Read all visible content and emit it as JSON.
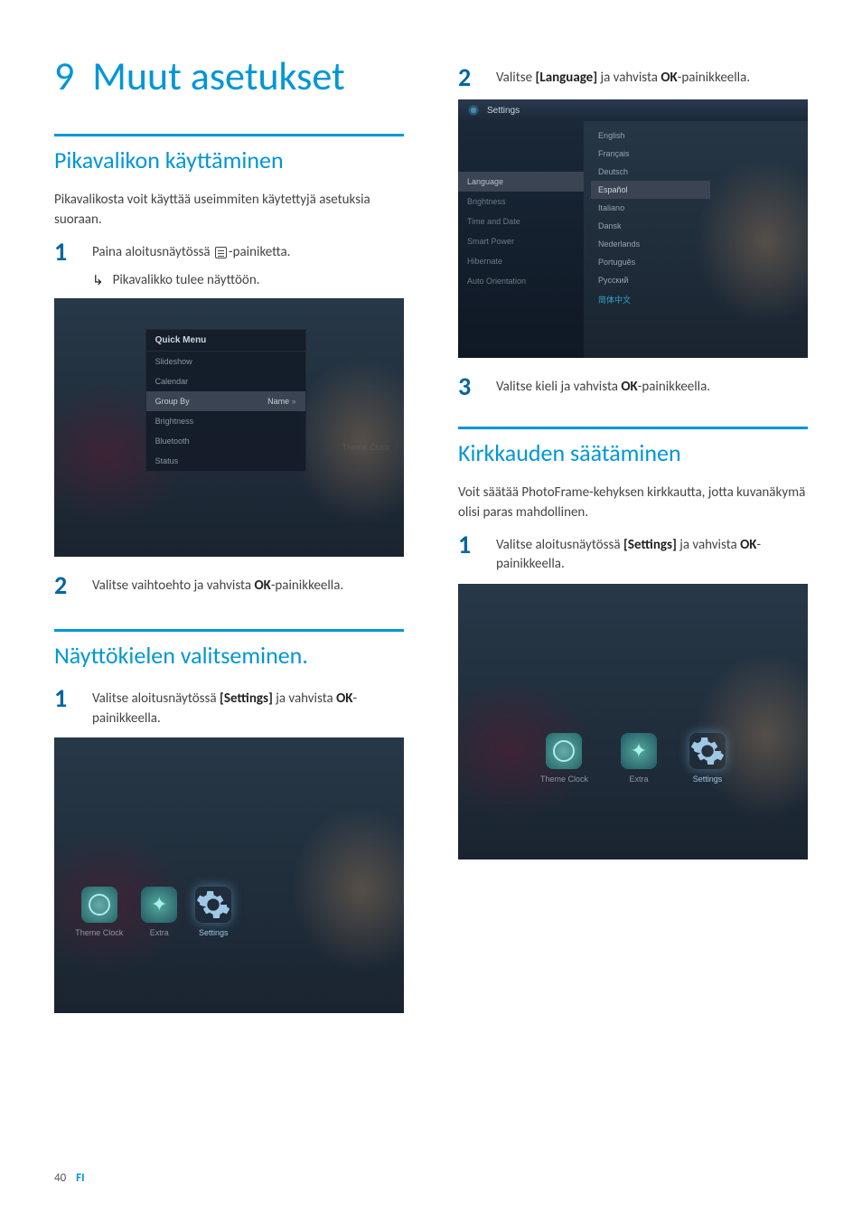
{
  "page": {
    "number": "40",
    "lang_code": "FI"
  },
  "chapter": {
    "number": "9",
    "title": "Muut asetukset"
  },
  "section_quickmenu": {
    "title": "Pikavalikon käyttäminen",
    "intro": "Pikavalikosta voit käyttää useimmiten käytettyjä asetuksia suoraan.",
    "step1_num": "1",
    "step1_a": "Paina aloitusnäytössä ",
    "step1_b": "-painiketta.",
    "sub1": "Pikavalikko tulee näyttöön.",
    "step2_num": "2",
    "step2_a": "Valitse vaihtoehto ja vahvista ",
    "step2_b": "OK",
    "step2_c": "-painikkeella."
  },
  "quickmenu_shot": {
    "header": "Quick Menu",
    "items": [
      "Slideshow",
      "Calendar",
      "Group By",
      "Brightness",
      "Bluetooth",
      "Status"
    ],
    "selected_index": 2,
    "selected_value": "Name",
    "watermark": "Theme Clock"
  },
  "section_language": {
    "title": "Näyttökielen valitseminen.",
    "step1_num": "1",
    "step1_a": "Valitse aloitusnäytössä ",
    "step1_b": "[Settings]",
    "step1_c": " ja vahvista ",
    "step1_d": "OK",
    "step1_e": "-painikkeella.",
    "step2_num": "2",
    "step2_a": "Valitse ",
    "step2_b": "[Language]",
    "step2_c": " ja vahvista ",
    "step2_d": "OK",
    "step2_e": "-painikkeella.",
    "step3_num": "3",
    "step3_a": "Valitse kieli ja vahvista ",
    "step3_b": "OK",
    "step3_c": "-painikkeella."
  },
  "home_shot": {
    "icons": [
      {
        "label": "Theme Clock"
      },
      {
        "label": "Extra"
      },
      {
        "label": "Settings"
      }
    ],
    "selected_index": 2
  },
  "settings_shot": {
    "bar_title": "Settings",
    "left_items": [
      "Language",
      "Brightness",
      "Time and Date",
      "Smart Power",
      "Hibernate",
      "Auto Orientation"
    ],
    "left_selected": 0,
    "languages": [
      "English",
      "Français",
      "Deutsch",
      "Español",
      "Italiano",
      "Dansk",
      "Nederlands",
      "Português",
      "Русский",
      "简体中文"
    ],
    "lang_selected": 9
  },
  "section_brightness": {
    "title": "Kirkkauden säätäminen",
    "intro": "Voit säätää PhotoFrame-kehyksen kirkkautta, jotta kuvanäkymä olisi paras mahdollinen.",
    "step1_num": "1",
    "step1_a": "Valitse aloitusnäytössä ",
    "step1_b": "[Settings]",
    "step1_c": " ja vahvista ",
    "step1_d": "OK",
    "step1_e": "-painikkeella."
  }
}
